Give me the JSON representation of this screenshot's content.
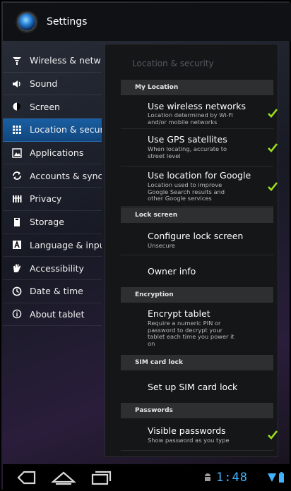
{
  "app": {
    "title": "Settings",
    "icon": "settings-app-icon"
  },
  "sidebar": {
    "items": [
      {
        "label": "Wireless & netw",
        "icon": "wifi-icon",
        "active": false
      },
      {
        "label": "Sound",
        "icon": "sound-icon",
        "active": false
      },
      {
        "label": "Screen",
        "icon": "screen-icon",
        "active": false
      },
      {
        "label": "Location & secur",
        "icon": "location-grid-icon",
        "active": true
      },
      {
        "label": "Applications",
        "icon": "applications-icon",
        "active": false
      },
      {
        "label": "Accounts & sync",
        "icon": "sync-icon",
        "active": false
      },
      {
        "label": "Privacy",
        "icon": "privacy-icon",
        "active": false
      },
      {
        "label": "Storage",
        "icon": "storage-icon",
        "active": false
      },
      {
        "label": "Language & inpu",
        "icon": "language-icon",
        "active": false
      },
      {
        "label": "Accessibility",
        "icon": "accessibility-icon",
        "active": false
      },
      {
        "label": "Date & time",
        "icon": "clock-icon",
        "active": false
      },
      {
        "label": "About tablet",
        "icon": "info-icon",
        "active": false
      }
    ]
  },
  "panel": {
    "title": "Location & security",
    "categories": {
      "my_location": "My Location",
      "lock_screen": "Lock screen",
      "encryption": "Encryption",
      "sim_card_lock": "SIM card lock",
      "passwords": "Passwords"
    },
    "prefs": {
      "wireless": {
        "title": "Use wireless networks",
        "summary": "Location determined by Wi-Fi and/or mobile networks",
        "checked": true
      },
      "gps": {
        "title": "Use GPS satellites",
        "summary": "When locating, accurate to street level",
        "checked": true
      },
      "google": {
        "title": "Use location for Google",
        "summary": "Location used to improve Google Search results and other Google services",
        "checked": true
      },
      "configure_lock": {
        "title": "Configure lock screen",
        "summary": "Unsecure"
      },
      "owner_info": {
        "title": "Owner info"
      },
      "encrypt": {
        "title": "Encrypt tablet",
        "summary": "Require a numeric PIN or password to decrypt your tablet each time you power it on"
      },
      "sim_lock": {
        "title": "Set up SIM card lock"
      },
      "visible_passwords": {
        "title": "Visible passwords",
        "summary": "Show password as you type",
        "checked": true
      }
    }
  },
  "navbar": {
    "clock": "1:48",
    "icons": [
      "back-icon",
      "home-icon",
      "recent-apps-icon",
      "android-notification-icon",
      "wifi-signal-icon",
      "battery-icon"
    ]
  },
  "colors": {
    "accent": "#3fb3ff",
    "check": "#9bdd1e",
    "selected": "#1a5fa3"
  }
}
